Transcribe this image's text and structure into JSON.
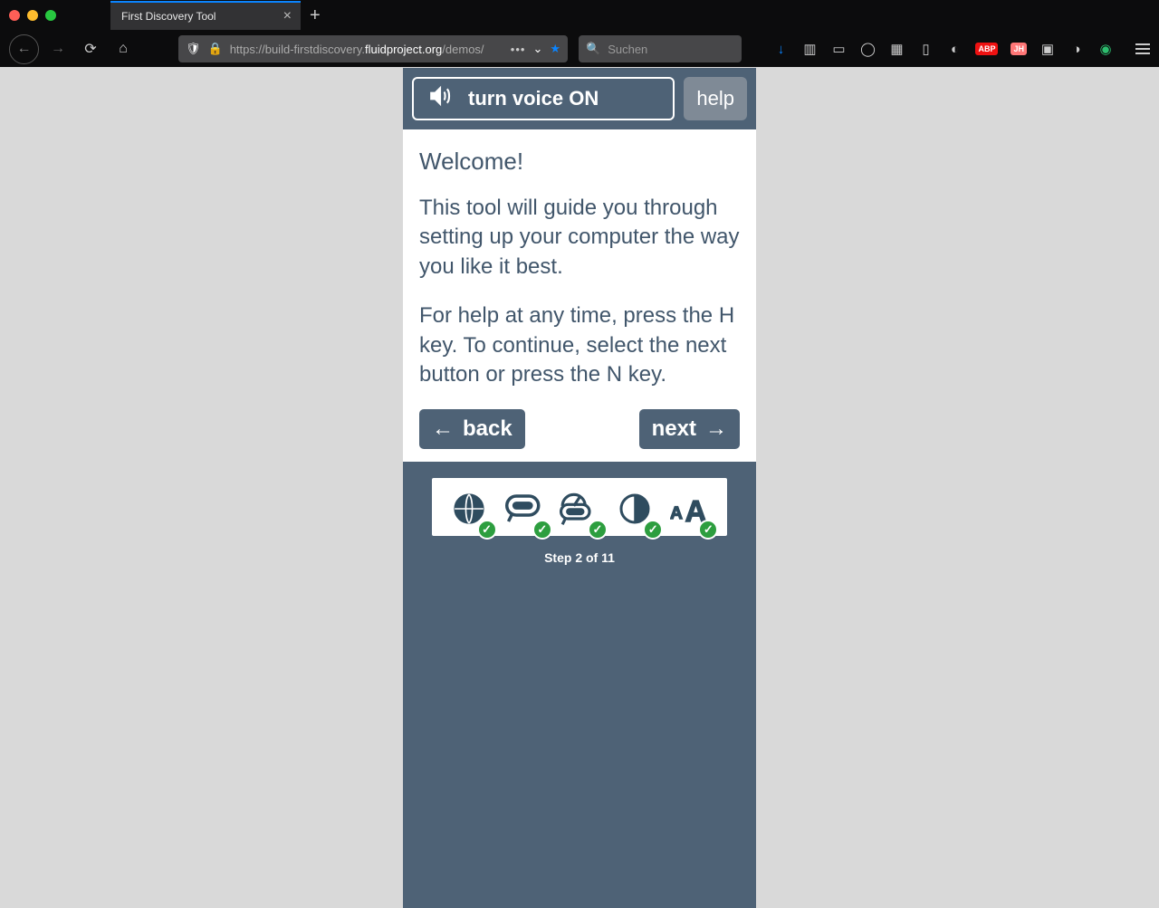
{
  "browser": {
    "tab_title": "First Discovery Tool",
    "url_prefix": "https://build-firstdiscovery.",
    "url_host": "fluidproject.org",
    "url_path": "/demos/",
    "search_placeholder": "Suchen"
  },
  "fd": {
    "voice_label": "turn voice ON",
    "help_label": "help",
    "welcome_heading": "Welcome!",
    "intro_text": "This tool will guide you through setting up your computer the way you like it best.",
    "help_text": "For help at any time, press the H key. To continue, select the next button or press the N key.",
    "back_label": "back",
    "next_label": "next",
    "step_label": "Step 2 of 11",
    "progress_items": [
      "language",
      "audio",
      "speech-rate",
      "contrast",
      "text-size"
    ]
  }
}
